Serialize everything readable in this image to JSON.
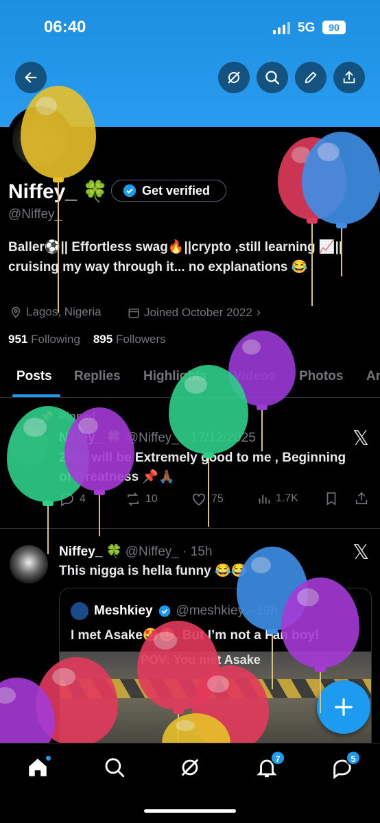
{
  "status_bar": {
    "time": "06:40",
    "network": "5G",
    "battery": "90"
  },
  "header": {
    "back_icon": "arrow-left-icon",
    "actions": [
      "grok-icon",
      "search-icon",
      "edit-icon",
      "share-icon"
    ]
  },
  "profile": {
    "name": "Niffey_ 🍀",
    "verify_label": "Get verified",
    "handle": "@Niffey_",
    "bio": "Baller⚽|| Effortless swag🔥||crypto ,still learning 📈|| cruising my way through it... no explanations 😂",
    "location": "Lagos, Nigeria",
    "joined": "Joined October 2022",
    "following_count": "951",
    "following_label": "Following",
    "followers_count": "895",
    "followers_label": "Followers"
  },
  "tabs": [
    "Posts",
    "Replies",
    "Highlights",
    "Videos",
    "Photos",
    "Ar"
  ],
  "posts": [
    {
      "pinned_label": "Pinned",
      "name": "Niffey_ 🍀",
      "handle_time": "@Niffey_ · 17/12/2025",
      "text": "2026 will be Extremely good to me , Beginning of Greatness 📌🙏🏾",
      "replies": "4",
      "reposts": "10",
      "likes": "75",
      "views": "1.7K"
    },
    {
      "name": "Niffey_ 🍀",
      "handle_time": "@Niffey_ · 15h",
      "text": "This nigga is hella funny 😂😂",
      "quote": {
        "name": "Meshkiey",
        "handle_time": "@meshkiey · 19h",
        "text": "I met Asake🤩🤩. But I’m not a Fan boy!",
        "media_caption": "POV: You met Asake"
      }
    }
  ],
  "fab_icon": "plus-icon",
  "nav": {
    "items": [
      "home-icon",
      "search-icon",
      "grok-icon",
      "notifications-icon",
      "messages-icon"
    ],
    "notifications_badge": "7",
    "messages_badge": "5"
  },
  "colors": {
    "accent": "#1d9bf0",
    "banner": "#2a9cf0",
    "background": "#000000"
  }
}
